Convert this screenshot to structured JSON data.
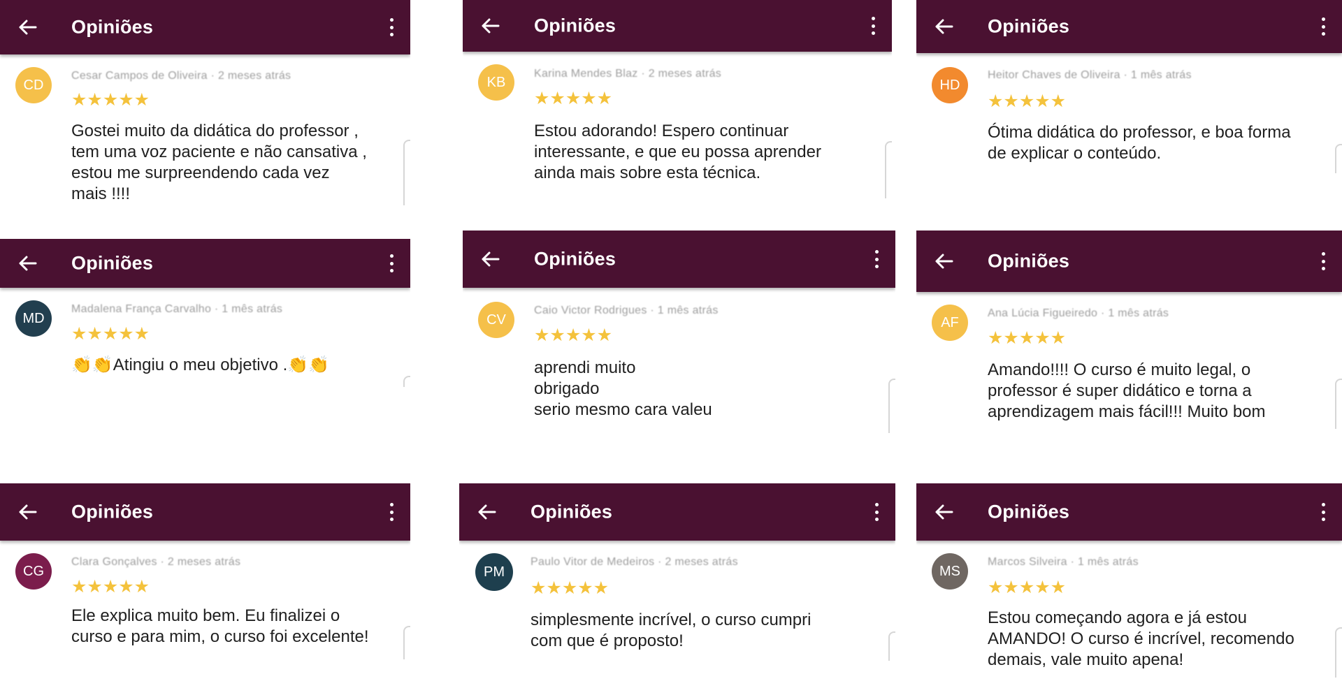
{
  "appbar": {
    "title": "Opiniões",
    "back_icon": "arrow-left-icon",
    "menu_icon": "more-vertical-icon"
  },
  "colors": {
    "appbar": "#4a1131",
    "star": "#f4c23c"
  },
  "reviews": [
    {
      "initials": "CD",
      "avatar_color": "#f5c04a",
      "reviewer": "Cesar Campos de Oliveira · 2 meses atrás",
      "stars": "★★★★★",
      "rating": 5,
      "text": "Gostei muito da didática do professor ,\ntem uma voz paciente e não cansativa ,\nestou me surpreendendo cada vez\nmais !!!!"
    },
    {
      "initials": "KB",
      "avatar_color": "#f5c04a",
      "reviewer": "Karina Mendes Blaz · 2 meses atrás",
      "stars": "★★★★★",
      "rating": 5,
      "text": "Estou adorando! Espero continuar\ninteressante, e que eu possa aprender\nainda mais sobre esta técnica."
    },
    {
      "initials": "HD",
      "avatar_color": "#f28a2e",
      "reviewer": "Heitor Chaves de Oliveira · 1 mês atrás",
      "stars": "★★★★★",
      "rating": 5,
      "text": "Ótima didática do professor, e boa forma\nde explicar o conteúdo."
    },
    {
      "initials": "MD",
      "avatar_color": "#223f4f",
      "reviewer": "Madalena França Carvalho · 1 mês atrás",
      "stars": "★★★★★",
      "rating": 5,
      "text": "👏👏Atingiu o meu objetivo .👏👏"
    },
    {
      "initials": "CV",
      "avatar_color": "#f5c04a",
      "reviewer": "Caio Victor Rodrigues · 1 mês atrás",
      "stars": "★★★★★",
      "rating": 5,
      "text": "aprendi muito\nobrigado\nserio mesmo cara valeu"
    },
    {
      "initials": "AF",
      "avatar_color": "#f5c04a",
      "reviewer": "Ana Lúcia Figueiredo · 1 mês atrás",
      "stars": "★★★★★",
      "rating": 5,
      "text": "Amando!!!! O curso é muito legal, o\nprofessor é super didático e torna a\naprendizagem mais fácil!!! Muito bom"
    },
    {
      "initials": "CG",
      "avatar_color": "#7b1d4c",
      "reviewer": "Clara Gonçalves · 2 meses atrás",
      "stars": "★★★★★",
      "rating": 5,
      "text": "Ele explica muito bem. Eu finalizei o\ncurso e para mim, o curso foi excelente!"
    },
    {
      "initials": "PM",
      "avatar_color": "#1e3f4e",
      "reviewer": "Paulo Vitor de Medeiros · 2 meses atrás",
      "stars": "★★★★★",
      "rating": 5,
      "text": "simplesmente incrível, o curso cumpri\ncom que é proposto!"
    },
    {
      "initials": "MS",
      "avatar_color": "#6f6762",
      "reviewer": "Marcos Silveira · 1 mês atrás",
      "stars": "★★★★★",
      "rating": 5,
      "text": "Estou começando agora e já estou\nAMANDO! O curso é incrível, recomendo\ndemais, vale muito apena!"
    }
  ]
}
